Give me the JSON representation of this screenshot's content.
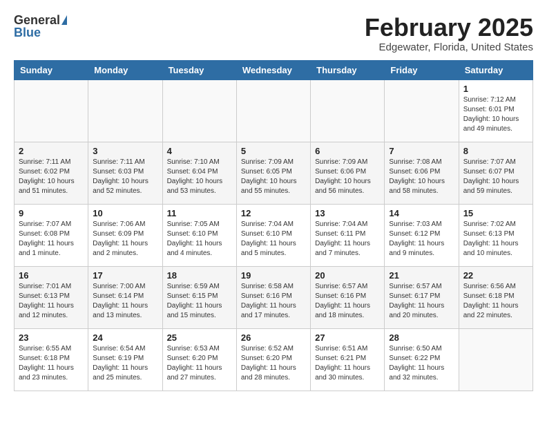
{
  "header": {
    "logo_general": "General",
    "logo_blue": "Blue",
    "title": "February 2025",
    "subtitle": "Edgewater, Florida, United States"
  },
  "weekdays": [
    "Sunday",
    "Monday",
    "Tuesday",
    "Wednesday",
    "Thursday",
    "Friday",
    "Saturday"
  ],
  "weeks": [
    [
      {
        "day": "",
        "info": ""
      },
      {
        "day": "",
        "info": ""
      },
      {
        "day": "",
        "info": ""
      },
      {
        "day": "",
        "info": ""
      },
      {
        "day": "",
        "info": ""
      },
      {
        "day": "",
        "info": ""
      },
      {
        "day": "1",
        "info": "Sunrise: 7:12 AM\nSunset: 6:01 PM\nDaylight: 10 hours and 49 minutes."
      }
    ],
    [
      {
        "day": "2",
        "info": "Sunrise: 7:11 AM\nSunset: 6:02 PM\nDaylight: 10 hours and 51 minutes."
      },
      {
        "day": "3",
        "info": "Sunrise: 7:11 AM\nSunset: 6:03 PM\nDaylight: 10 hours and 52 minutes."
      },
      {
        "day": "4",
        "info": "Sunrise: 7:10 AM\nSunset: 6:04 PM\nDaylight: 10 hours and 53 minutes."
      },
      {
        "day": "5",
        "info": "Sunrise: 7:09 AM\nSunset: 6:05 PM\nDaylight: 10 hours and 55 minutes."
      },
      {
        "day": "6",
        "info": "Sunrise: 7:09 AM\nSunset: 6:06 PM\nDaylight: 10 hours and 56 minutes."
      },
      {
        "day": "7",
        "info": "Sunrise: 7:08 AM\nSunset: 6:06 PM\nDaylight: 10 hours and 58 minutes."
      },
      {
        "day": "8",
        "info": "Sunrise: 7:07 AM\nSunset: 6:07 PM\nDaylight: 10 hours and 59 minutes."
      }
    ],
    [
      {
        "day": "9",
        "info": "Sunrise: 7:07 AM\nSunset: 6:08 PM\nDaylight: 11 hours and 1 minute."
      },
      {
        "day": "10",
        "info": "Sunrise: 7:06 AM\nSunset: 6:09 PM\nDaylight: 11 hours and 2 minutes."
      },
      {
        "day": "11",
        "info": "Sunrise: 7:05 AM\nSunset: 6:10 PM\nDaylight: 11 hours and 4 minutes."
      },
      {
        "day": "12",
        "info": "Sunrise: 7:04 AM\nSunset: 6:10 PM\nDaylight: 11 hours and 5 minutes."
      },
      {
        "day": "13",
        "info": "Sunrise: 7:04 AM\nSunset: 6:11 PM\nDaylight: 11 hours and 7 minutes."
      },
      {
        "day": "14",
        "info": "Sunrise: 7:03 AM\nSunset: 6:12 PM\nDaylight: 11 hours and 9 minutes."
      },
      {
        "day": "15",
        "info": "Sunrise: 7:02 AM\nSunset: 6:13 PM\nDaylight: 11 hours and 10 minutes."
      }
    ],
    [
      {
        "day": "16",
        "info": "Sunrise: 7:01 AM\nSunset: 6:13 PM\nDaylight: 11 hours and 12 minutes."
      },
      {
        "day": "17",
        "info": "Sunrise: 7:00 AM\nSunset: 6:14 PM\nDaylight: 11 hours and 13 minutes."
      },
      {
        "day": "18",
        "info": "Sunrise: 6:59 AM\nSunset: 6:15 PM\nDaylight: 11 hours and 15 minutes."
      },
      {
        "day": "19",
        "info": "Sunrise: 6:58 AM\nSunset: 6:16 PM\nDaylight: 11 hours and 17 minutes."
      },
      {
        "day": "20",
        "info": "Sunrise: 6:57 AM\nSunset: 6:16 PM\nDaylight: 11 hours and 18 minutes."
      },
      {
        "day": "21",
        "info": "Sunrise: 6:57 AM\nSunset: 6:17 PM\nDaylight: 11 hours and 20 minutes."
      },
      {
        "day": "22",
        "info": "Sunrise: 6:56 AM\nSunset: 6:18 PM\nDaylight: 11 hours and 22 minutes."
      }
    ],
    [
      {
        "day": "23",
        "info": "Sunrise: 6:55 AM\nSunset: 6:18 PM\nDaylight: 11 hours and 23 minutes."
      },
      {
        "day": "24",
        "info": "Sunrise: 6:54 AM\nSunset: 6:19 PM\nDaylight: 11 hours and 25 minutes."
      },
      {
        "day": "25",
        "info": "Sunrise: 6:53 AM\nSunset: 6:20 PM\nDaylight: 11 hours and 27 minutes."
      },
      {
        "day": "26",
        "info": "Sunrise: 6:52 AM\nSunset: 6:20 PM\nDaylight: 11 hours and 28 minutes."
      },
      {
        "day": "27",
        "info": "Sunrise: 6:51 AM\nSunset: 6:21 PM\nDaylight: 11 hours and 30 minutes."
      },
      {
        "day": "28",
        "info": "Sunrise: 6:50 AM\nSunset: 6:22 PM\nDaylight: 11 hours and 32 minutes."
      },
      {
        "day": "",
        "info": ""
      }
    ]
  ]
}
